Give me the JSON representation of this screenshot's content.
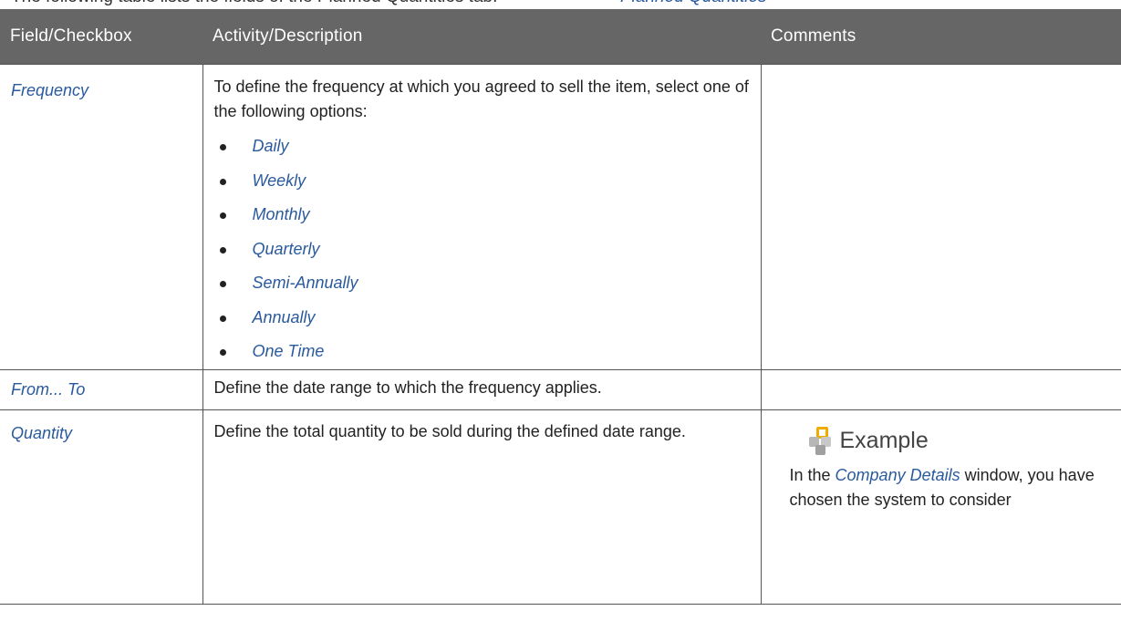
{
  "intro": {
    "text": "The following table lists the fields of the Planned Quantities tab:",
    "link": "Planned Quantities"
  },
  "table": {
    "headers": [
      "Field/Checkbox",
      "Activity/Description",
      "Comments"
    ],
    "rows": [
      {
        "field": "Frequency",
        "description": "To define the frequency at which you agreed to sell the item, select one of the following options:",
        "options": [
          "Daily",
          "Weekly",
          "Monthly",
          "Quarterly",
          "Semi-Annually",
          "Annually",
          "One Time"
        ],
        "comment": ""
      },
      {
        "field": "From... To",
        "description": "Define the date range to which the frequency applies.",
        "comment": ""
      },
      {
        "field": "Quantity",
        "description": "Define the total quantity to be sold during the defined date range.",
        "comment": {
          "label": "Example",
          "text_before": "In the ",
          "link": "Company Details",
          "text_after": " window, you have chosen the system to consider"
        }
      }
    ]
  }
}
